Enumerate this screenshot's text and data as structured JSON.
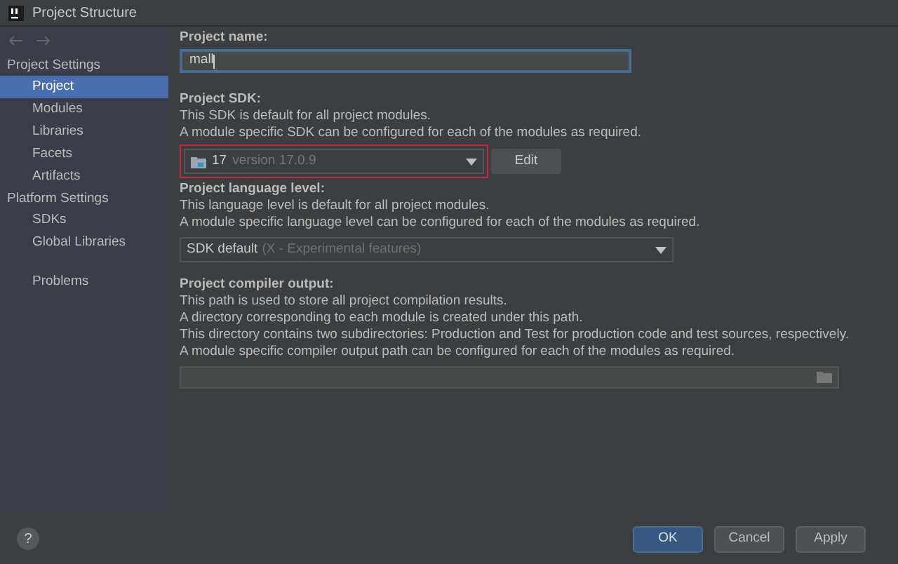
{
  "window": {
    "title": "Project Structure"
  },
  "sidebar": {
    "sections": [
      {
        "heading": "Project Settings",
        "items": [
          {
            "label": "Project",
            "selected": true
          },
          {
            "label": "Modules",
            "selected": false
          },
          {
            "label": "Libraries",
            "selected": false
          },
          {
            "label": "Facets",
            "selected": false
          },
          {
            "label": "Artifacts",
            "selected": false
          }
        ]
      },
      {
        "heading": "Platform Settings",
        "items": [
          {
            "label": "SDKs",
            "selected": false
          },
          {
            "label": "Global Libraries",
            "selected": false
          }
        ]
      },
      {
        "items": [
          {
            "label": "Problems",
            "selected": false
          }
        ]
      }
    ]
  },
  "project_name": {
    "label": "Project name:",
    "value": "mall",
    "focused": true
  },
  "project_sdk": {
    "label": "Project SDK:",
    "description": [
      "This SDK is default for all project modules.",
      "A module specific SDK can be configured for each of the modules as required."
    ],
    "value": "17",
    "detail": "version 17.0.9",
    "highlighted": true,
    "button": "Edit"
  },
  "language_level": {
    "label": "Project language level:",
    "description": [
      "This language level is default for all project modules.",
      "A module specific language level can be configured for each of the modules as required."
    ],
    "value": "SDK default",
    "detail": "(X - Experimental features)"
  },
  "compiler_output": {
    "label": "Project compiler output:",
    "description": [
      "This path is used to store all project compilation results.",
      "A directory corresponding to each module is created under this path.",
      "This directory contains two subdirectories: Production and Test for production code and test sources, respectively.",
      "A module specific compiler output path can be configured for each of the modules as required."
    ]
  },
  "help": "?",
  "buttons": [
    {
      "label": "OK",
      "default": true
    },
    {
      "label": "Cancel",
      "default": false
    },
    {
      "label": "Apply",
      "default": false
    }
  ]
}
